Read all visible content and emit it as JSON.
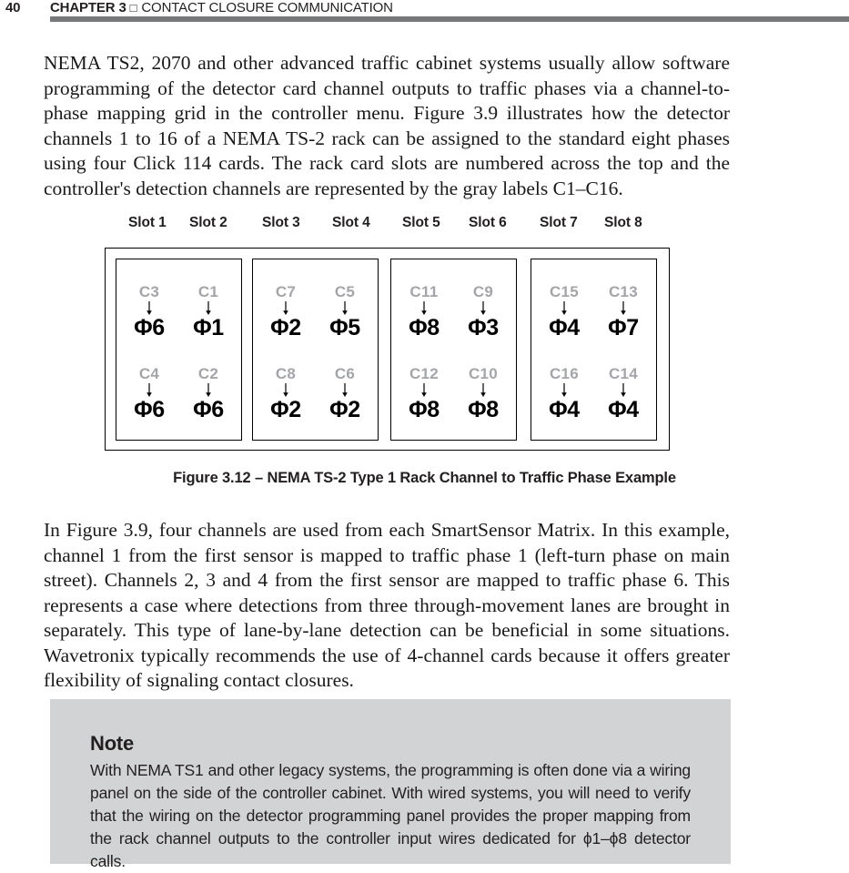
{
  "header": {
    "page_number": "40",
    "chapter_label": "CHAPTER 3",
    "separator_glyph": "□",
    "section_title": "CONTACT CLOSURE COMMUNICATION",
    "rule_color": "#76787a"
  },
  "body": {
    "paragraph_1": "NEMA TS2, 2070 and other advanced traffic cabinet systems usually allow software programming of the detector card channel outputs to traffic phases via a channel-to-phase mapping grid in the controller menu. Figure 3.9 illustrates how the detector channels 1 to 16 of a NEMA TS-2 rack can be assigned to the standard eight phases using four Click 114 cards. The rack card slots are numbered  across the top and the controller's detection channels are represented by the gray labels C1–C16.",
    "paragraph_2": "In Figure 3.9, four channels are used from each SmartSensor Matrix. In this example, channel 1 from the first sensor is mapped to traffic phase 1 (left-turn phase on main street). Channels 2, 3 and 4 from the first sensor are mapped to traffic phase 6. This represents a case where detections from three through-movement lanes are brought in separately. This type of lane-by-lane detection can be beneficial in some situations. Wavetronix typically recommends the use of 4-channel cards because it offers greater flexibility of signaling contact closures."
  },
  "figure": {
    "caption": "Figure 3.12 – NEMA TS-2 Type 1 Rack Channel to Traffic Phase Example",
    "slot_labels": [
      "Slot 1",
      "Slot 2",
      "Slot 3",
      "Slot 4",
      "Slot 5",
      "Slot 6",
      "Slot 7",
      "Slot 8"
    ],
    "channel_label_color": "#a3a5a8",
    "phase_label_color": "#000000",
    "arrow_glyph": "↓",
    "cards": [
      {
        "card_index": 1,
        "slots": [
          "Slot 1",
          "Slot 2"
        ],
        "cells": [
          {
            "channel": "C3",
            "phase": "Φ6"
          },
          {
            "channel": "C1",
            "phase": "Φ1"
          },
          {
            "channel": "C4",
            "phase": "Φ6"
          },
          {
            "channel": "C2",
            "phase": "Φ6"
          }
        ]
      },
      {
        "card_index": 2,
        "slots": [
          "Slot 3",
          "Slot 4"
        ],
        "cells": [
          {
            "channel": "C7",
            "phase": "Φ2"
          },
          {
            "channel": "C5",
            "phase": "Φ5"
          },
          {
            "channel": "C8",
            "phase": "Φ2"
          },
          {
            "channel": "C6",
            "phase": "Φ2"
          }
        ]
      },
      {
        "card_index": 3,
        "slots": [
          "Slot 5",
          "Slot 6"
        ],
        "cells": [
          {
            "channel": "C11",
            "phase": "Φ8"
          },
          {
            "channel": "C9",
            "phase": "Φ3"
          },
          {
            "channel": "C12",
            "phase": "Φ8"
          },
          {
            "channel": "C10",
            "phase": "Φ8"
          }
        ]
      },
      {
        "card_index": 4,
        "slots": [
          "Slot 7",
          "Slot 8"
        ],
        "cells": [
          {
            "channel": "C15",
            "phase": "Φ4"
          },
          {
            "channel": "C13",
            "phase": "Φ7"
          },
          {
            "channel": "C16",
            "phase": "Φ4"
          },
          {
            "channel": "C14",
            "phase": "Φ4"
          }
        ]
      }
    ]
  },
  "note": {
    "title": "Note",
    "body": "With NEMA TS1 and other legacy systems, the programming is often done via a wiring panel on the side of the controller cabinet. With wired systems, you will need to verify that the wiring on the detector programming panel provides the proper mapping from the rack channel outputs to the controller input wires dedicated for ϕ1–ϕ8 detector calls.",
    "background_color": "#d2d3d4"
  }
}
